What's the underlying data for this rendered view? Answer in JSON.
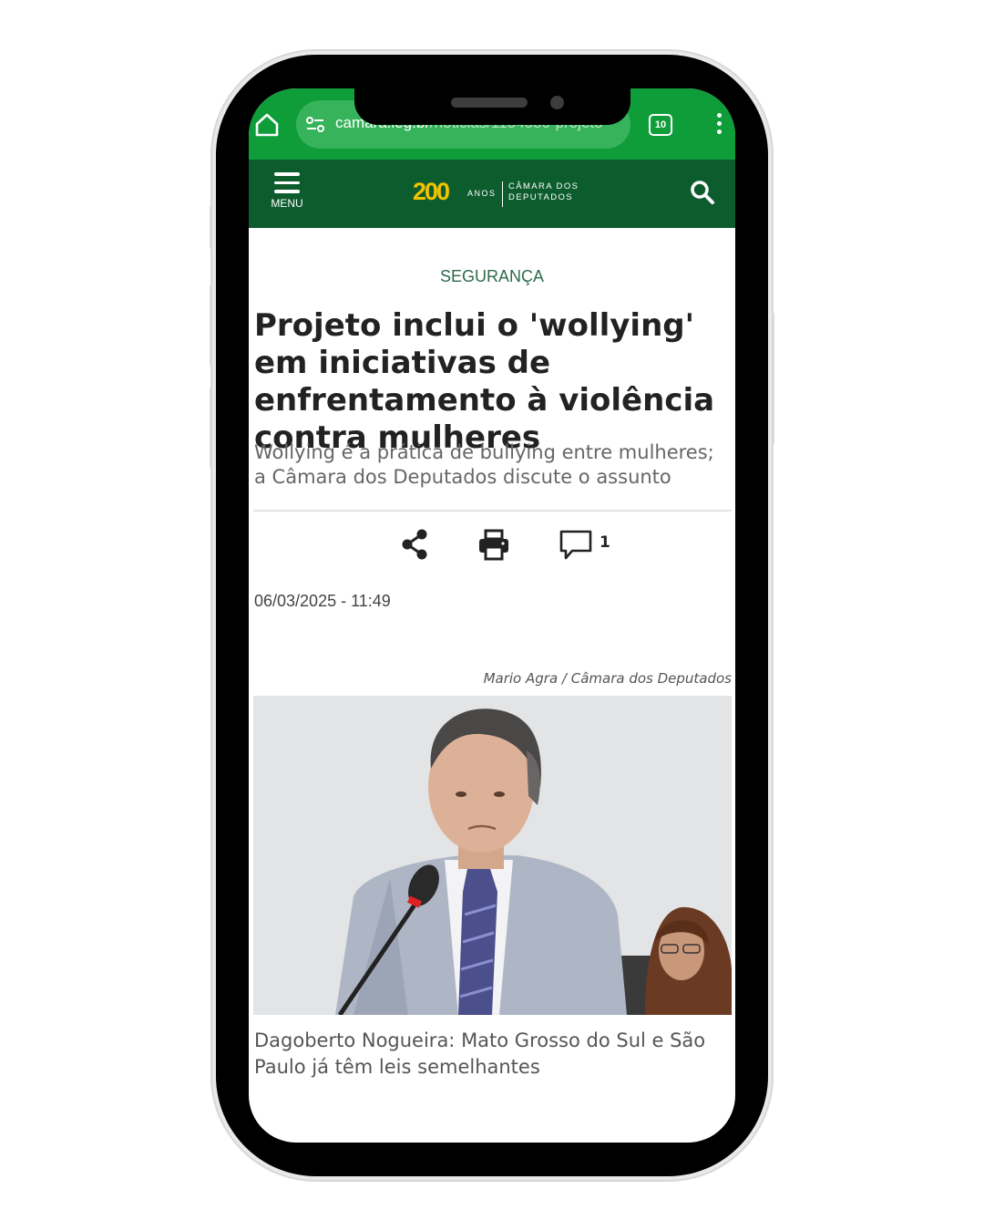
{
  "browser": {
    "url_host": "camara.leg.br",
    "url_path": "/noticias/1134580-projeto",
    "tab_count": "10"
  },
  "site": {
    "menu_label": "MENU",
    "logo_number": "200",
    "logo_anos": "ANOS",
    "logo_line1": "CÂMARA DOS",
    "logo_line2": "DEPUTADOS"
  },
  "article": {
    "category": "SEGURANÇA",
    "headline": "Projeto inclui o 'wollying' em iniciativas de enfrentamento à violência contra mulheres",
    "subtitle": "Wollying é a prática de bullying entre mulheres; a Câmara dos Deputados discute o assunto",
    "comment_count": "1",
    "date": "06/03/2025 - 11:49",
    "photo_credit": "Mario Agra / Câmara dos Deputados",
    "photo_caption": "Dagoberto Nogueira: Mato Grosso do Sul e São Paulo já têm leis semelhantes"
  },
  "icons": [
    "home-icon",
    "site-settings-icon",
    "tabs-icon",
    "more-vert-icon",
    "menu-icon",
    "search-icon",
    "share-icon",
    "print-icon",
    "comment-icon"
  ],
  "colors": {
    "browser_green": "#0f9d3a",
    "header_green": "#0d5c2e",
    "category_green": "#2e6b4a"
  }
}
